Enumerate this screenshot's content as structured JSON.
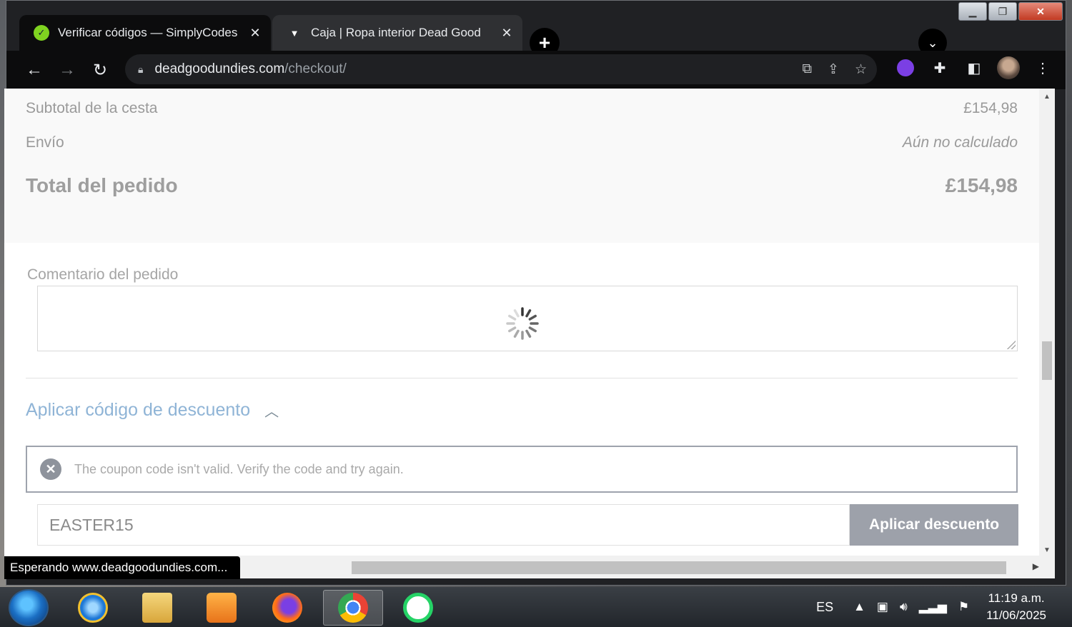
{
  "tabs": [
    {
      "title": "Verificar códigos — SimplyCodes",
      "favicon": "simplycodes-icon",
      "active": true
    },
    {
      "title": "Caja | Ropa interior Dead Good",
      "favicon": "deadgood-icon",
      "active": false
    }
  ],
  "toolbar": {
    "url_host": "deadgoodundies.com",
    "url_path": "/checkout/"
  },
  "summary": {
    "subtotal_label": "Subtotal de la cesta",
    "subtotal_value": "£154,98",
    "shipping_label": "Envío",
    "shipping_value": "Aún no calculado",
    "total_label": "Total del pedido",
    "total_value": "£154,98"
  },
  "comment": {
    "label": "Comentario del pedido",
    "value": ""
  },
  "discount": {
    "toggle_label": "Aplicar código de descuento",
    "error_message": "The coupon code isn't valid. Verify the code and try again.",
    "code_value": "EASTER15",
    "apply_label": "Aplicar descuento"
  },
  "status_bar": "Esperando www.deadgoodundies.com...",
  "taskbar": {
    "language": "ES",
    "time": "11:19 a.m.",
    "date": "11/06/2025"
  },
  "colors": {
    "accent_link": "#8fb4d6",
    "button": "#9da1aa",
    "browser_dark": "#0c0c0d"
  }
}
